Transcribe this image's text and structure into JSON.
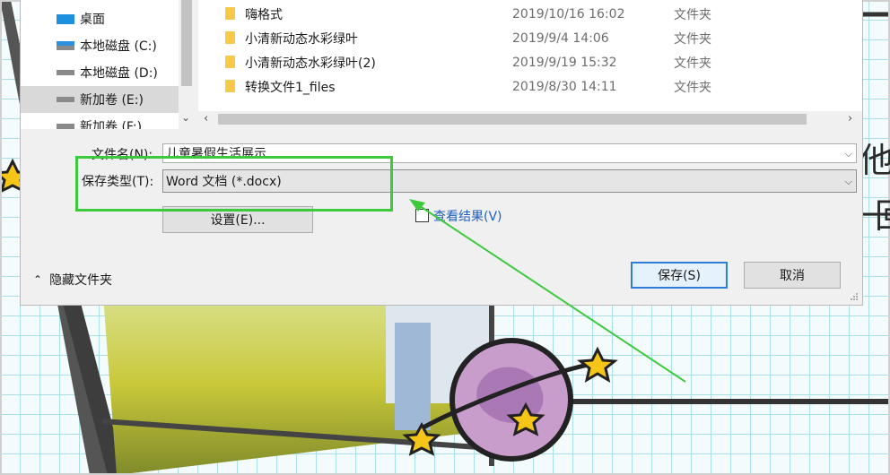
{
  "background": {
    "chars": [
      "他",
      "一",
      "回"
    ]
  },
  "nav": {
    "items": [
      {
        "label": "桌面",
        "icon": "desktop-icon"
      },
      {
        "label": "本地磁盘 (C:)",
        "icon": "drive-windows-icon"
      },
      {
        "label": "本地磁盘 (D:)",
        "icon": "drive-icon"
      },
      {
        "label": "新加卷 (E:)",
        "icon": "drive-icon",
        "selected": true
      },
      {
        "label": "新加卷 (F:)",
        "icon": "drive-icon"
      }
    ]
  },
  "files": [
    {
      "name": "嗨格式",
      "date": "2019/10/16 16:02",
      "type": "文件夹"
    },
    {
      "name": "小清新动态水彩绿叶",
      "date": "2019/9/4 14:06",
      "type": "文件夹"
    },
    {
      "name": "小清新动态水彩绿叶(2)",
      "date": "2019/9/19 15:32",
      "type": "文件夹"
    },
    {
      "name": "转换文件1_files",
      "date": "2019/8/30 14:11",
      "type": "文件夹"
    }
  ],
  "form": {
    "filename_label": "文件名(N):",
    "filename_value": "儿童暑假生活展示",
    "type_label": "保存类型(T):",
    "type_value": "Word 文档 (*.docx)",
    "settings_label": "设置(E)...",
    "view_results_label": "查看结果(V)",
    "hide_folders_label": "隐藏文件夹",
    "save_label": "保存(S)",
    "cancel_label": "取消"
  },
  "colors": {
    "highlight": "#3cc93c",
    "accent": "#2e7dd6"
  }
}
